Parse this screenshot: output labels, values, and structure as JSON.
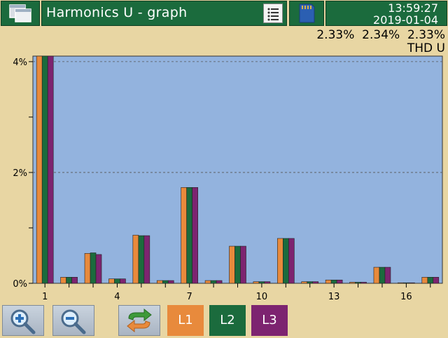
{
  "header": {
    "title": "Harmonics U - graph",
    "time": "13:59:27",
    "date": "2019-01-04",
    "icons": [
      "windows-icon",
      "list-icon",
      "sd-card-icon"
    ]
  },
  "thd": {
    "values": "2.33%  2.34%  2.33%",
    "label": "THD U"
  },
  "chart_data": {
    "type": "bar",
    "categories": [
      1,
      2,
      3,
      4,
      5,
      6,
      7,
      8,
      9,
      10,
      11,
      12,
      13,
      14,
      15,
      16,
      17
    ],
    "x_tick_labels": [
      "1",
      "4",
      "7",
      "10",
      "13",
      "16"
    ],
    "y_tick_labels": [
      "4%",
      "2%",
      "0%"
    ],
    "ylim": [
      0,
      4.1
    ],
    "series": [
      {
        "name": "L1",
        "color": "#e88a3c",
        "values": [
          4.1,
          0.11,
          0.54,
          0.08,
          0.87,
          0.05,
          1.73,
          0.05,
          0.67,
          0.03,
          0.81,
          0.03,
          0.06,
          0.02,
          0.29,
          0.01,
          0.11
        ]
      },
      {
        "name": "L2",
        "color": "#1b6b3d",
        "values": [
          4.1,
          0.11,
          0.55,
          0.08,
          0.86,
          0.05,
          1.73,
          0.05,
          0.67,
          0.03,
          0.81,
          0.03,
          0.06,
          0.02,
          0.29,
          0.01,
          0.11
        ]
      },
      {
        "name": "L3",
        "color": "#7d2470",
        "values": [
          4.1,
          0.11,
          0.52,
          0.08,
          0.86,
          0.05,
          1.73,
          0.05,
          0.67,
          0.03,
          0.81,
          0.03,
          0.06,
          0.02,
          0.29,
          0.01,
          0.11
        ]
      }
    ],
    "grid": true,
    "plot_background": "#93b3de"
  },
  "footer": {
    "buttons": [
      {
        "icon": "zoom-in-icon"
      },
      {
        "icon": "zoom-out-icon"
      },
      {
        "icon": "swap-icon"
      }
    ],
    "phase_labels": [
      "L1",
      "L2",
      "L3"
    ]
  }
}
